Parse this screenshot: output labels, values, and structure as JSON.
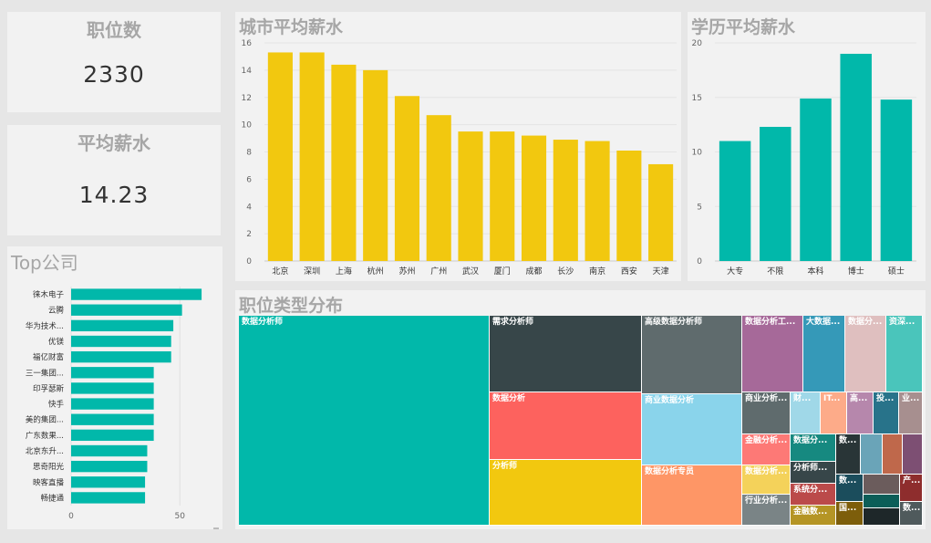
{
  "kpi_jobs": {
    "title": "职位数",
    "value": "2330"
  },
  "kpi_salary": {
    "title": "平均薪水",
    "value": "14.23"
  },
  "chart_data": [
    {
      "id": "city",
      "type": "bar",
      "title": "城市平均薪水",
      "categories": [
        "北京",
        "深圳",
        "上海",
        "杭州",
        "苏州",
        "广州",
        "武汉",
        "厦门",
        "成都",
        "长沙",
        "南京",
        "西安",
        "天津"
      ],
      "values": [
        15.3,
        15.3,
        14.4,
        14.0,
        12.1,
        10.7,
        9.5,
        9.5,
        9.2,
        8.9,
        8.8,
        8.1,
        7.1
      ],
      "ylim": [
        0,
        16
      ],
      "yticks": [
        0,
        2,
        4,
        6,
        8,
        10,
        12,
        14,
        16
      ],
      "color": "#f2c80f",
      "grid": true
    },
    {
      "id": "edu",
      "type": "bar",
      "title": "学历平均薪水",
      "categories": [
        "大专",
        "不限",
        "本科",
        "博士",
        "硕士"
      ],
      "values": [
        11.0,
        12.3,
        14.9,
        19.0,
        14.8
      ],
      "ylim": [
        0,
        20
      ],
      "yticks": [
        0,
        5,
        10,
        15,
        20
      ],
      "color": "#01b8aa",
      "grid": true
    },
    {
      "id": "company",
      "type": "bar",
      "orientation": "horizontal",
      "title": "Top公司",
      "categories": [
        "徕木电子",
        "云腾",
        "华为技术...",
        "优镁",
        "福亿财富",
        "三一集团...",
        "印孚瑟斯",
        "快手",
        "美的集团...",
        "广东数果...",
        "北京东升...",
        "思奇阳光",
        "映客直播",
        "畅捷通"
      ],
      "values": [
        60,
        51,
        47,
        46,
        46,
        38,
        38,
        38,
        38,
        38,
        35,
        35,
        34,
        34
      ],
      "xlim": [
        0,
        65
      ],
      "xticks": [
        0,
        50
      ],
      "color": "#01b8aa"
    },
    {
      "id": "treemap",
      "type": "treemap",
      "title": "职位类型分布",
      "cells": [
        {
          "label": "数据分析师",
          "color": "#01b8aa"
        },
        {
          "label": "需求分析师",
          "color": "#374649"
        },
        {
          "label": "数据分析",
          "color": "#fd625e"
        },
        {
          "label": "分析师",
          "color": "#f2c80f"
        },
        {
          "label": "高级数据分析师",
          "color": "#5f6b6d"
        },
        {
          "label": "商业数据分析",
          "color": "#8ad4eb"
        },
        {
          "label": "数据分析专员",
          "color": "#fe9666"
        },
        {
          "label": "数据分析工...",
          "color": "#a66999"
        },
        {
          "label": "大数据...",
          "color": "#3599b8"
        },
        {
          "label": "数据分...",
          "color": "#dfbfbf"
        },
        {
          "label": "资深...",
          "color": "#4ac5bb"
        },
        {
          "label": "商业分析...",
          "color": "#5f6b6d"
        },
        {
          "label": "财...",
          "color": "#a0d8e8"
        },
        {
          "label": "IT...",
          "color": "#fdab89"
        },
        {
          "label": "高...",
          "color": "#b687ac"
        },
        {
          "label": "投...",
          "color": "#28738a"
        },
        {
          "label": "业...",
          "color": "#a78f8f"
        },
        {
          "label": "金融分析...",
          "color": "#fd7976"
        },
        {
          "label": "数据分析...",
          "color": "#f4d25a"
        },
        {
          "label": "行业分析...",
          "color": "#7a8486"
        },
        {
          "label": "数据分...",
          "color": "#168980"
        },
        {
          "label": "数...",
          "color": "#293537"
        },
        {
          "label": "",
          "color": "#6aa4b8"
        },
        {
          "label": "",
          "color": "#bf684b"
        },
        {
          "label": "",
          "color": "#7d4f73"
        },
        {
          "label": "分析师...",
          "color": "#374649"
        },
        {
          "label": "系统分...",
          "color": "#bb4a4a"
        },
        {
          "label": "数...",
          "color": "#1b4d5c"
        },
        {
          "label": "",
          "color": "#6b5c5c"
        },
        {
          "label": "产...",
          "color": "#8e2d2d"
        },
        {
          "label": "",
          "color": "#0c5e58"
        },
        {
          "label": "金融数...",
          "color": "#b59525"
        },
        {
          "label": "国...",
          "color": "#7d5e0b"
        },
        {
          "label": "",
          "color": "#1e2729"
        },
        {
          "label": "数...",
          "color": "#4f5a5c"
        }
      ]
    }
  ]
}
